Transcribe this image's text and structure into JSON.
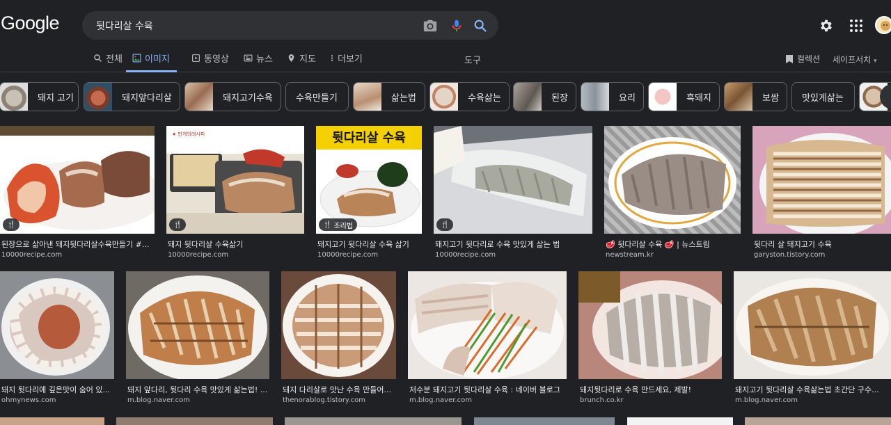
{
  "logo": "Google",
  "search": {
    "query": "뒷다리살 수육"
  },
  "tabs": [
    {
      "label": "전체",
      "icon": "search-icon"
    },
    {
      "label": "이미지",
      "icon": "image-icon",
      "active": true
    },
    {
      "label": "동영상",
      "icon": "video-icon"
    },
    {
      "label": "뉴스",
      "icon": "news-icon"
    },
    {
      "label": "지도",
      "icon": "map-pin-icon"
    },
    {
      "label": "더보기",
      "icon": "more-icon"
    }
  ],
  "tools_label": "도구",
  "collections_label": "컬렉션",
  "safesearch_label": "세이프서치",
  "chips": [
    {
      "label": "돼지 고기",
      "thumb": true
    },
    {
      "label": "돼지앞다리살",
      "thumb": true
    },
    {
      "label": "돼지고기수육",
      "thumb": true
    },
    {
      "label": "수육만들기",
      "thumb": false
    },
    {
      "label": "삶는법",
      "thumb": true
    },
    {
      "label": "수육삶는",
      "thumb": true
    },
    {
      "label": "된장",
      "thumb": true
    },
    {
      "label": "요리",
      "thumb": true
    },
    {
      "label": "흑돼지",
      "thumb": true
    },
    {
      "label": "보쌈",
      "thumb": true
    },
    {
      "label": "맛있게삶는",
      "thumb": false
    },
    {
      "label": "",
      "thumb": true
    }
  ],
  "results_row1": [
    {
      "caption": "된장으로 삶아낸 돼지뒷다리살수육만들기 #...",
      "source": "10000recipe.com",
      "badge": "",
      "badge_icon": "fork-knife-icon"
    },
    {
      "caption": "돼지 뒷다리살 수육삶기",
      "source": "10000recipe.com",
      "badge": "",
      "badge_icon": "fork-knife-icon"
    },
    {
      "caption": "돼지고기 뒷다리살 수육 삶기",
      "source": "10000recipe.com",
      "badge": "조리법",
      "badge_icon": "fork-knife-icon",
      "image_title": "뒷다리살 수육"
    },
    {
      "caption": "돼지고기 뒷다리로 수육 맛있게 삶는 법",
      "source": "10000recipe.com",
      "badge": "",
      "badge_icon": "fork-knife-icon"
    },
    {
      "caption": "🥩 뒷다리살 수육 🥩 | 뉴스트림",
      "source": "newstream.kr",
      "badge": "",
      "badge_icon": ""
    },
    {
      "caption": "뒷다리 살 돼지고기 수육",
      "source": "garyston.tistory.com",
      "badge": "",
      "badge_icon": ""
    }
  ],
  "results_row2": [
    {
      "caption": "돼지 뒷다리에 깊은맛이 숨어 있...",
      "source": "ohmynews.com"
    },
    {
      "caption": "돼지 앞다리, 뒷다리 수육 맛있게 삶는법! ...",
      "source": "m.blog.naver.com"
    },
    {
      "caption": "돼지 다리살로 맛난 수육 만들어...",
      "source": "thenorablog.tistory.com"
    },
    {
      "caption": "저수분 돼지고기 뒷다리살 수육 : 네이버 블로그",
      "source": "m.blog.naver.com"
    },
    {
      "caption": "돼지뒷다리로 수육 만드세요, 제발!",
      "source": "brunch.co.kr"
    },
    {
      "caption": "돼지고기 뒷다리살 수육삶는법 초간단 구수...",
      "source": "m.blog.naver.com"
    }
  ]
}
